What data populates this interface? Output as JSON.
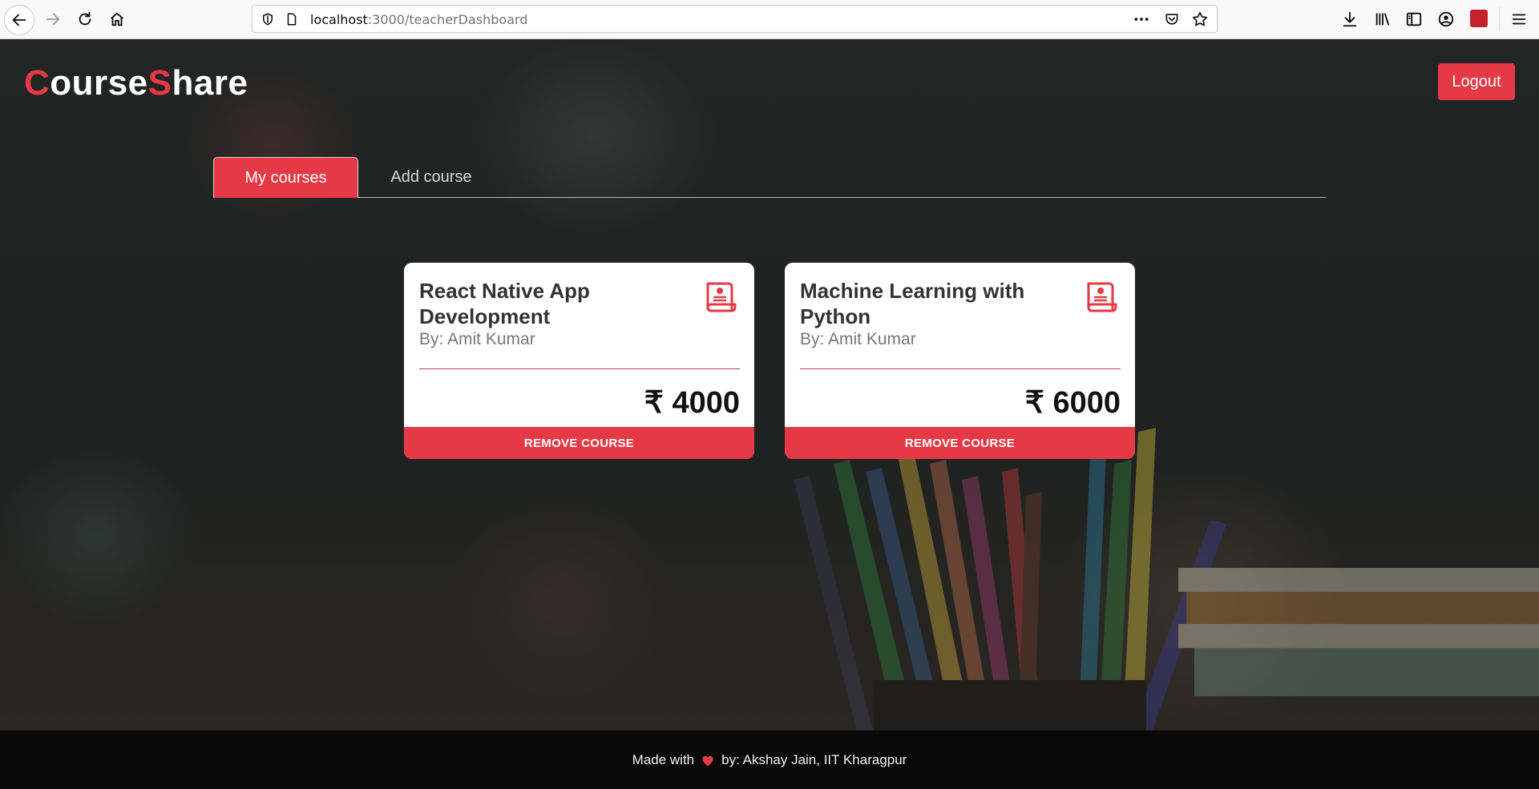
{
  "browser": {
    "url_host": "localhost",
    "url_path": ":3000/teacherDashboard",
    "icons": [
      "back-icon",
      "forward-icon",
      "reload-icon",
      "home-icon",
      "shield-icon",
      "page-icon",
      "more-icon",
      "pocket-icon",
      "star-icon",
      "download-icon",
      "library-icon",
      "sidebar-icon",
      "account-icon",
      "extension-icon",
      "menu-icon"
    ]
  },
  "header": {
    "logo_first_initial": "C",
    "logo_first_rest": "ourse",
    "logo_second_initial": "S",
    "logo_second_rest": "hare",
    "logout_label": "Logout"
  },
  "tabs": [
    {
      "label": "My courses",
      "active": true
    },
    {
      "label": "Add course",
      "active": false
    }
  ],
  "courses": [
    {
      "title": "React Native App Development",
      "author": "By: Amit Kumar",
      "price": "₹ 4000",
      "remove_label": "REMOVE COURSE",
      "icon": "certificate-scroll-icon"
    },
    {
      "title": "Machine Learning with Python",
      "author": "By: Amit Kumar",
      "price": "₹ 6000",
      "remove_label": "REMOVE COURSE",
      "icon": "certificate-scroll-icon"
    }
  ],
  "footer": {
    "made_with": "Made with",
    "by_text": "by: Akshay Jain, IIT Kharagpur"
  },
  "colors": {
    "accent": "#e63946",
    "footer_bg": "#090909",
    "card_bg": "#ffffff"
  }
}
